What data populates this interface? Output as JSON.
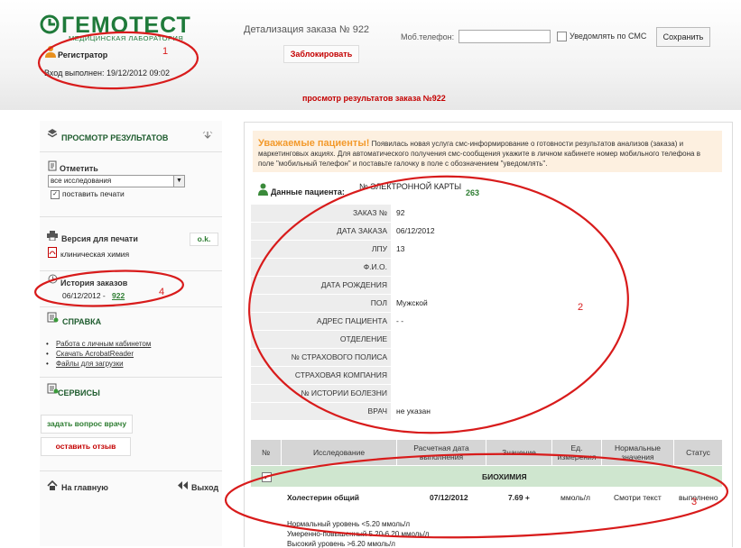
{
  "header": {
    "logo": "ГЕМОТЕСТ",
    "logo_sub": "МЕДИЦИНСКАЯ ЛАБОРАТОРИЯ",
    "role": "Регистратор",
    "login": "Вход выполнен: 19/12/2012 09:02",
    "order_title": "Детализация заказа № 922",
    "block_button": "Заблокировать",
    "phone_label": "Моб.телефон:",
    "phone_value": "",
    "sms_label": "Уведомлять по СМС",
    "save_button": "Сохранить",
    "banner": "просмотр результатов заказа №922"
  },
  "sidebar": {
    "results_title": "ПРОСМОТР РЕЗУЛЬТАТОВ",
    "mark_label": "Отметить",
    "select_value": "все исследования",
    "print_check": "поставить печати",
    "print_version": "Версия для печати",
    "ok_button": "o.k.",
    "chem_label": "клиническая химия",
    "history_title": "История заказов",
    "history_date": "06/12/2012 -",
    "history_link": "922",
    "help_title": "СПРАВКА",
    "help_links": [
      "Работа с личным кабинетом",
      "Скачать AcrobatReader",
      "Файлы для загрузки"
    ],
    "services_title": "СЕРВИСЫ",
    "ask_doctor": "задать вопрос врачу",
    "leave_review": "оставить отзыв",
    "home": "На главную",
    "exit": "Выход"
  },
  "notice": {
    "title": "Уважаемые пациенты!",
    "body": "Появилась новая услуга смс-информирование о готовности результатов анализов (заказа) и маркетинговых акциях. Для автоматического получения смс-сообщения укажите в личном кабинете номер мобильного телефона в поле \"мобильный телефон\" и поставьте галочку в поле с обозначением \"уведомлять\"."
  },
  "patient": {
    "label": "Данные пациента:",
    "card_label": "№ ЭЛЕКТРОННОЙ КАРТЫ",
    "card_number": "263",
    "rows": [
      {
        "label": "ЗАКАЗ №",
        "value": "92"
      },
      {
        "label": "ДАТА ЗАКАЗА",
        "value": "06/12/2012"
      },
      {
        "label": "ЛПУ",
        "value": "13"
      },
      {
        "label": "Ф.И.О.",
        "value": ""
      },
      {
        "label": "ДАТА РОЖДЕНИЯ",
        "value": ""
      },
      {
        "label": "ПОЛ",
        "value": "Мужской"
      },
      {
        "label": "АДРЕС ПАЦИЕНТА",
        "value": "- -"
      },
      {
        "label": "ОТДЕЛЕНИЕ",
        "value": ""
      },
      {
        "label": "№ СТРАХОВОГО ПОЛИСА",
        "value": ""
      },
      {
        "label": "СТРАХОВАЯ КОМПАНИЯ",
        "value": ""
      },
      {
        "label": "№ ИСТОРИИ БОЛЕЗНИ",
        "value": ""
      },
      {
        "label": "ВРАЧ",
        "value": "не указан"
      }
    ]
  },
  "results": {
    "columns": [
      "№",
      "Исследование",
      "Расчетная дата выполнения",
      "Значение",
      "Ед. измерения",
      "Нормальные значения",
      "Статус"
    ],
    "group_check": "✓",
    "group_name": "БИОХИМИЯ",
    "row": {
      "name": "Холестерин общий",
      "date": "07/12/2012",
      "value": "7.69 +",
      "unit": "ммоль/л",
      "norm": "Смотри текст",
      "status": "выполнено"
    },
    "norm_lines": [
      "Нормальный уровень <5.20 ммоль/л",
      "Умеренно-повышенный 5.20-6.20 ммоль/л",
      "Высокий уровень >6.20 ммоль/л"
    ]
  },
  "annotations": [
    "1",
    "2",
    "3",
    "4"
  ]
}
